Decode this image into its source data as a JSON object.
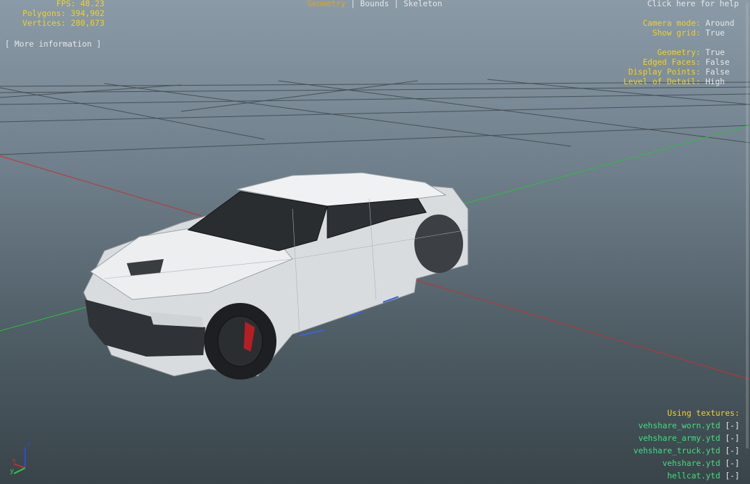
{
  "stats": {
    "fps": "FPS: 48.23",
    "polygons_label": "Polygons:",
    "polygons": "394,902",
    "vertices_label": "Vertices:",
    "vertices": "280,673"
  },
  "more_info": "[ More information ]",
  "modes": {
    "geometry": "Geometry",
    "sep1": " | ",
    "bounds": "Bounds",
    "sep2": " | ",
    "skeleton": "Skeleton"
  },
  "help": "Click here for help",
  "settings": [
    {
      "label": "Camera mode:",
      "value": "Around"
    },
    {
      "label": "Show grid:",
      "value": "True"
    },
    {
      "label": "Geometry:",
      "value": "True"
    },
    {
      "label": "Edged Faces:",
      "value": "False"
    },
    {
      "label": "Display Points:",
      "value": "False"
    },
    {
      "label": "Level of Detail:",
      "value": "High"
    }
  ],
  "textures": {
    "title": "Using textures:",
    "toggle": "[-]",
    "items": [
      "vehshare_worn.ytd",
      "vehshare_army.ytd",
      "vehshare_truck.ytd",
      "vehshare.ytd",
      "hellcat.ytd"
    ]
  },
  "axes": {
    "z": "z",
    "x": "x",
    "y": "y"
  },
  "colors": {
    "hud_label": "#f2d21e",
    "hud_value": "#e8e8e8",
    "texture_name": "#3fe07a",
    "active_mode": "#e5a41a",
    "axis_x": "#d12a2a",
    "axis_y": "#2fcf3f",
    "axis_z": "#2a4fd1"
  }
}
